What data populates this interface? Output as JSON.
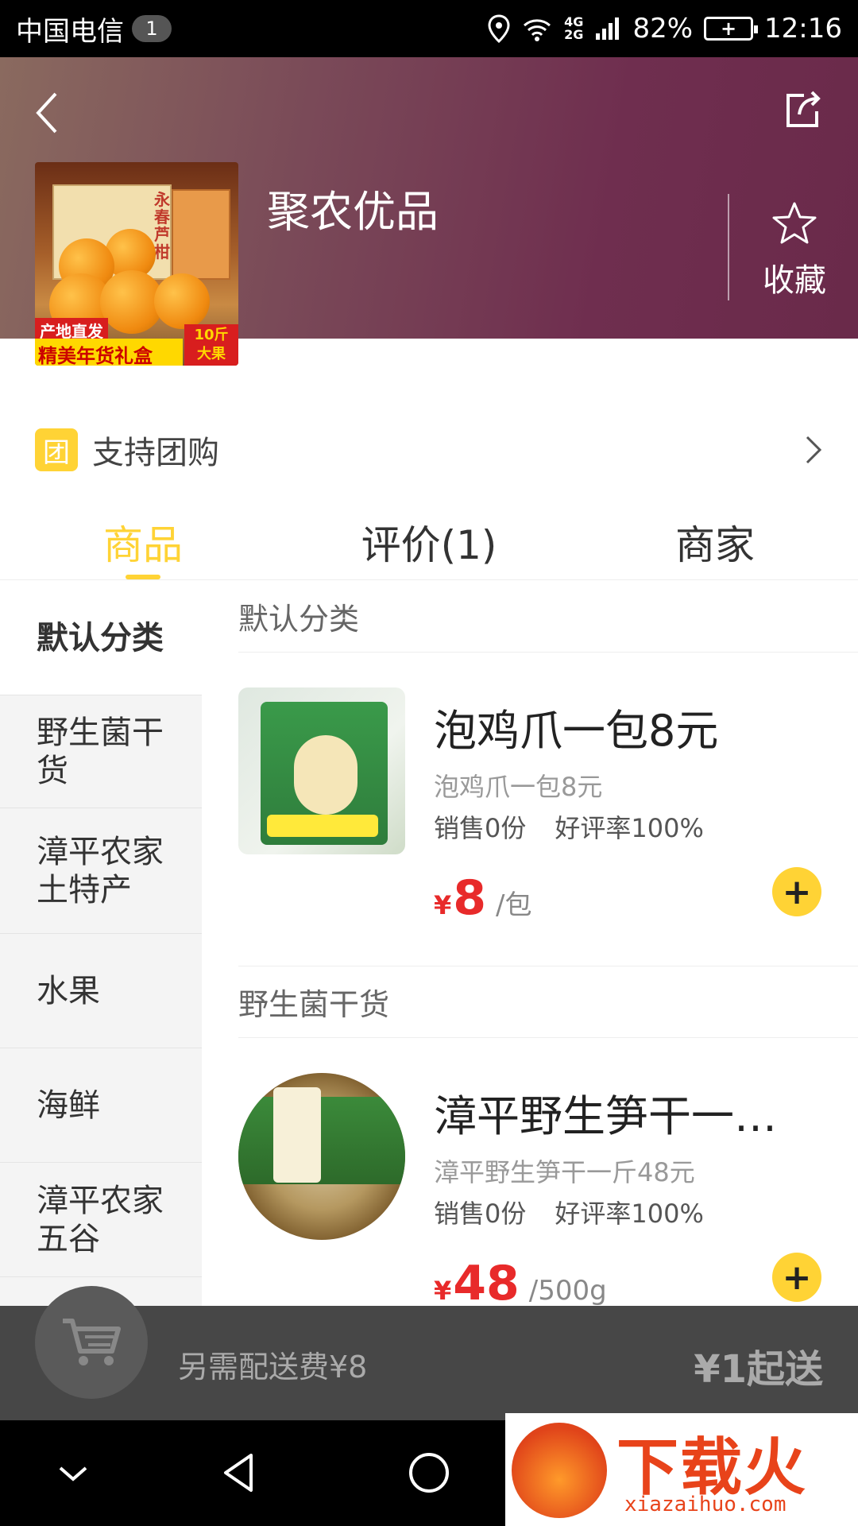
{
  "status_bar": {
    "carrier": "中国电信",
    "notification_count": "1",
    "network": [
      "4G",
      "2G"
    ],
    "battery": "82%",
    "time": "12:16"
  },
  "store": {
    "name": "聚农优品",
    "favorite_label": "收藏",
    "logo_text": {
      "box_label": "永春芦柑",
      "tag_origin": "产地直发",
      "tag_gift": "精美年货礼盒",
      "tag_weight": "10斤",
      "tag_size": "大果"
    }
  },
  "group_buy": {
    "icon_text": "团",
    "label": "支持团购"
  },
  "tabs": [
    {
      "label": "商品",
      "active": true
    },
    {
      "label": "评价(1)",
      "active": false
    },
    {
      "label": "商家",
      "active": false
    }
  ],
  "categories": [
    {
      "label": "默认分类",
      "active": true
    },
    {
      "label": "野生菌干货"
    },
    {
      "label": "漳平农家土特产"
    },
    {
      "label": "水果"
    },
    {
      "label": "海鲜"
    },
    {
      "label": "漳平农家五谷"
    }
  ],
  "sections": [
    {
      "title": "默认分类",
      "item": {
        "name": "泡鸡爪一包8元",
        "subtitle": "泡鸡爪一包8元",
        "sales": "销售0份",
        "rating": "好评率100%",
        "currency": "¥",
        "price": "8",
        "unit": "/包"
      }
    },
    {
      "title": "野生菌干货",
      "item": {
        "name": "漳平野生笋干一…",
        "subtitle": "漳平野生笋干一斤48元",
        "sales": "销售0份",
        "rating": "好评率100%",
        "currency": "¥",
        "price": "48",
        "unit": "/500g"
      }
    }
  ],
  "cart": {
    "delivery_fee": "另需配送费¥8",
    "min_order": "¥1起送"
  },
  "watermark": {
    "text": "下载火",
    "url": "xiazaihuo.com"
  },
  "colors": {
    "accent": "#ffd335",
    "price": "#e82a2a",
    "header_start": "#8a6a5f",
    "header_end": "#6a2a4a"
  }
}
